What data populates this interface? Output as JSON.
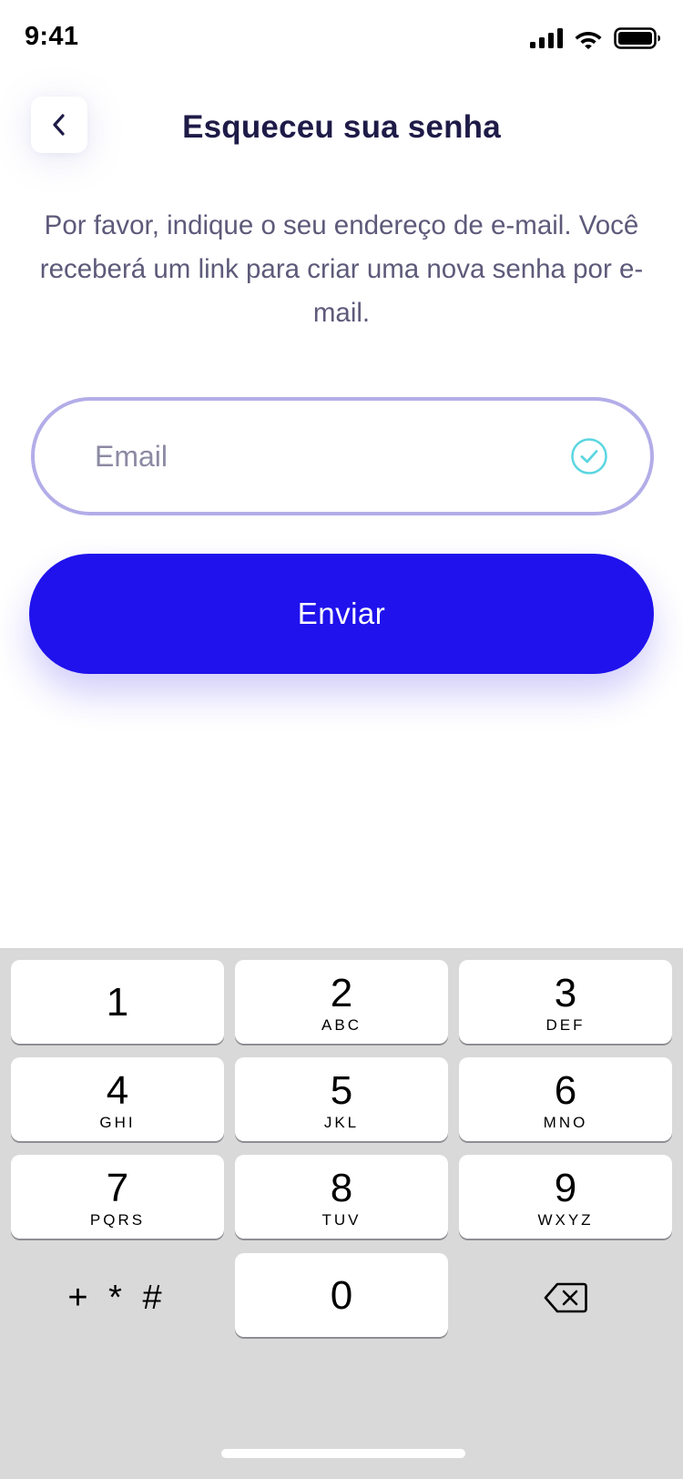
{
  "status_bar": {
    "time": "9:41"
  },
  "header": {
    "title": "Esqueceu sua senha"
  },
  "description": "Por favor, indique o seu endereço de e-mail. Você receberá um link para criar uma nova senha por e-mail.",
  "email_field": {
    "placeholder": "Email",
    "value": ""
  },
  "submit": {
    "label": "Enviar"
  },
  "keypad": {
    "keys": [
      {
        "digit": "1",
        "letters": ""
      },
      {
        "digit": "2",
        "letters": "ABC"
      },
      {
        "digit": "3",
        "letters": "DEF"
      },
      {
        "digit": "4",
        "letters": "GHI"
      },
      {
        "digit": "5",
        "letters": "JKL"
      },
      {
        "digit": "6",
        "letters": "MNO"
      },
      {
        "digit": "7",
        "letters": "PQRS"
      },
      {
        "digit": "8",
        "letters": "TUV"
      },
      {
        "digit": "9",
        "letters": "WXYZ"
      },
      {
        "digit": "0",
        "letters": ""
      }
    ],
    "symbols": "+ * #"
  },
  "colors": {
    "accent": "#1f12ec",
    "field_border": "#b3ade8",
    "check": "#5ad6e0",
    "title": "#1e1b48",
    "body_text": "#5d5a7a"
  },
  "icons": {
    "back": "chevron-left-icon",
    "check": "check-circle-icon",
    "delete": "backspace-icon",
    "signal": "signal-icon",
    "wifi": "wifi-icon",
    "battery": "battery-icon"
  }
}
